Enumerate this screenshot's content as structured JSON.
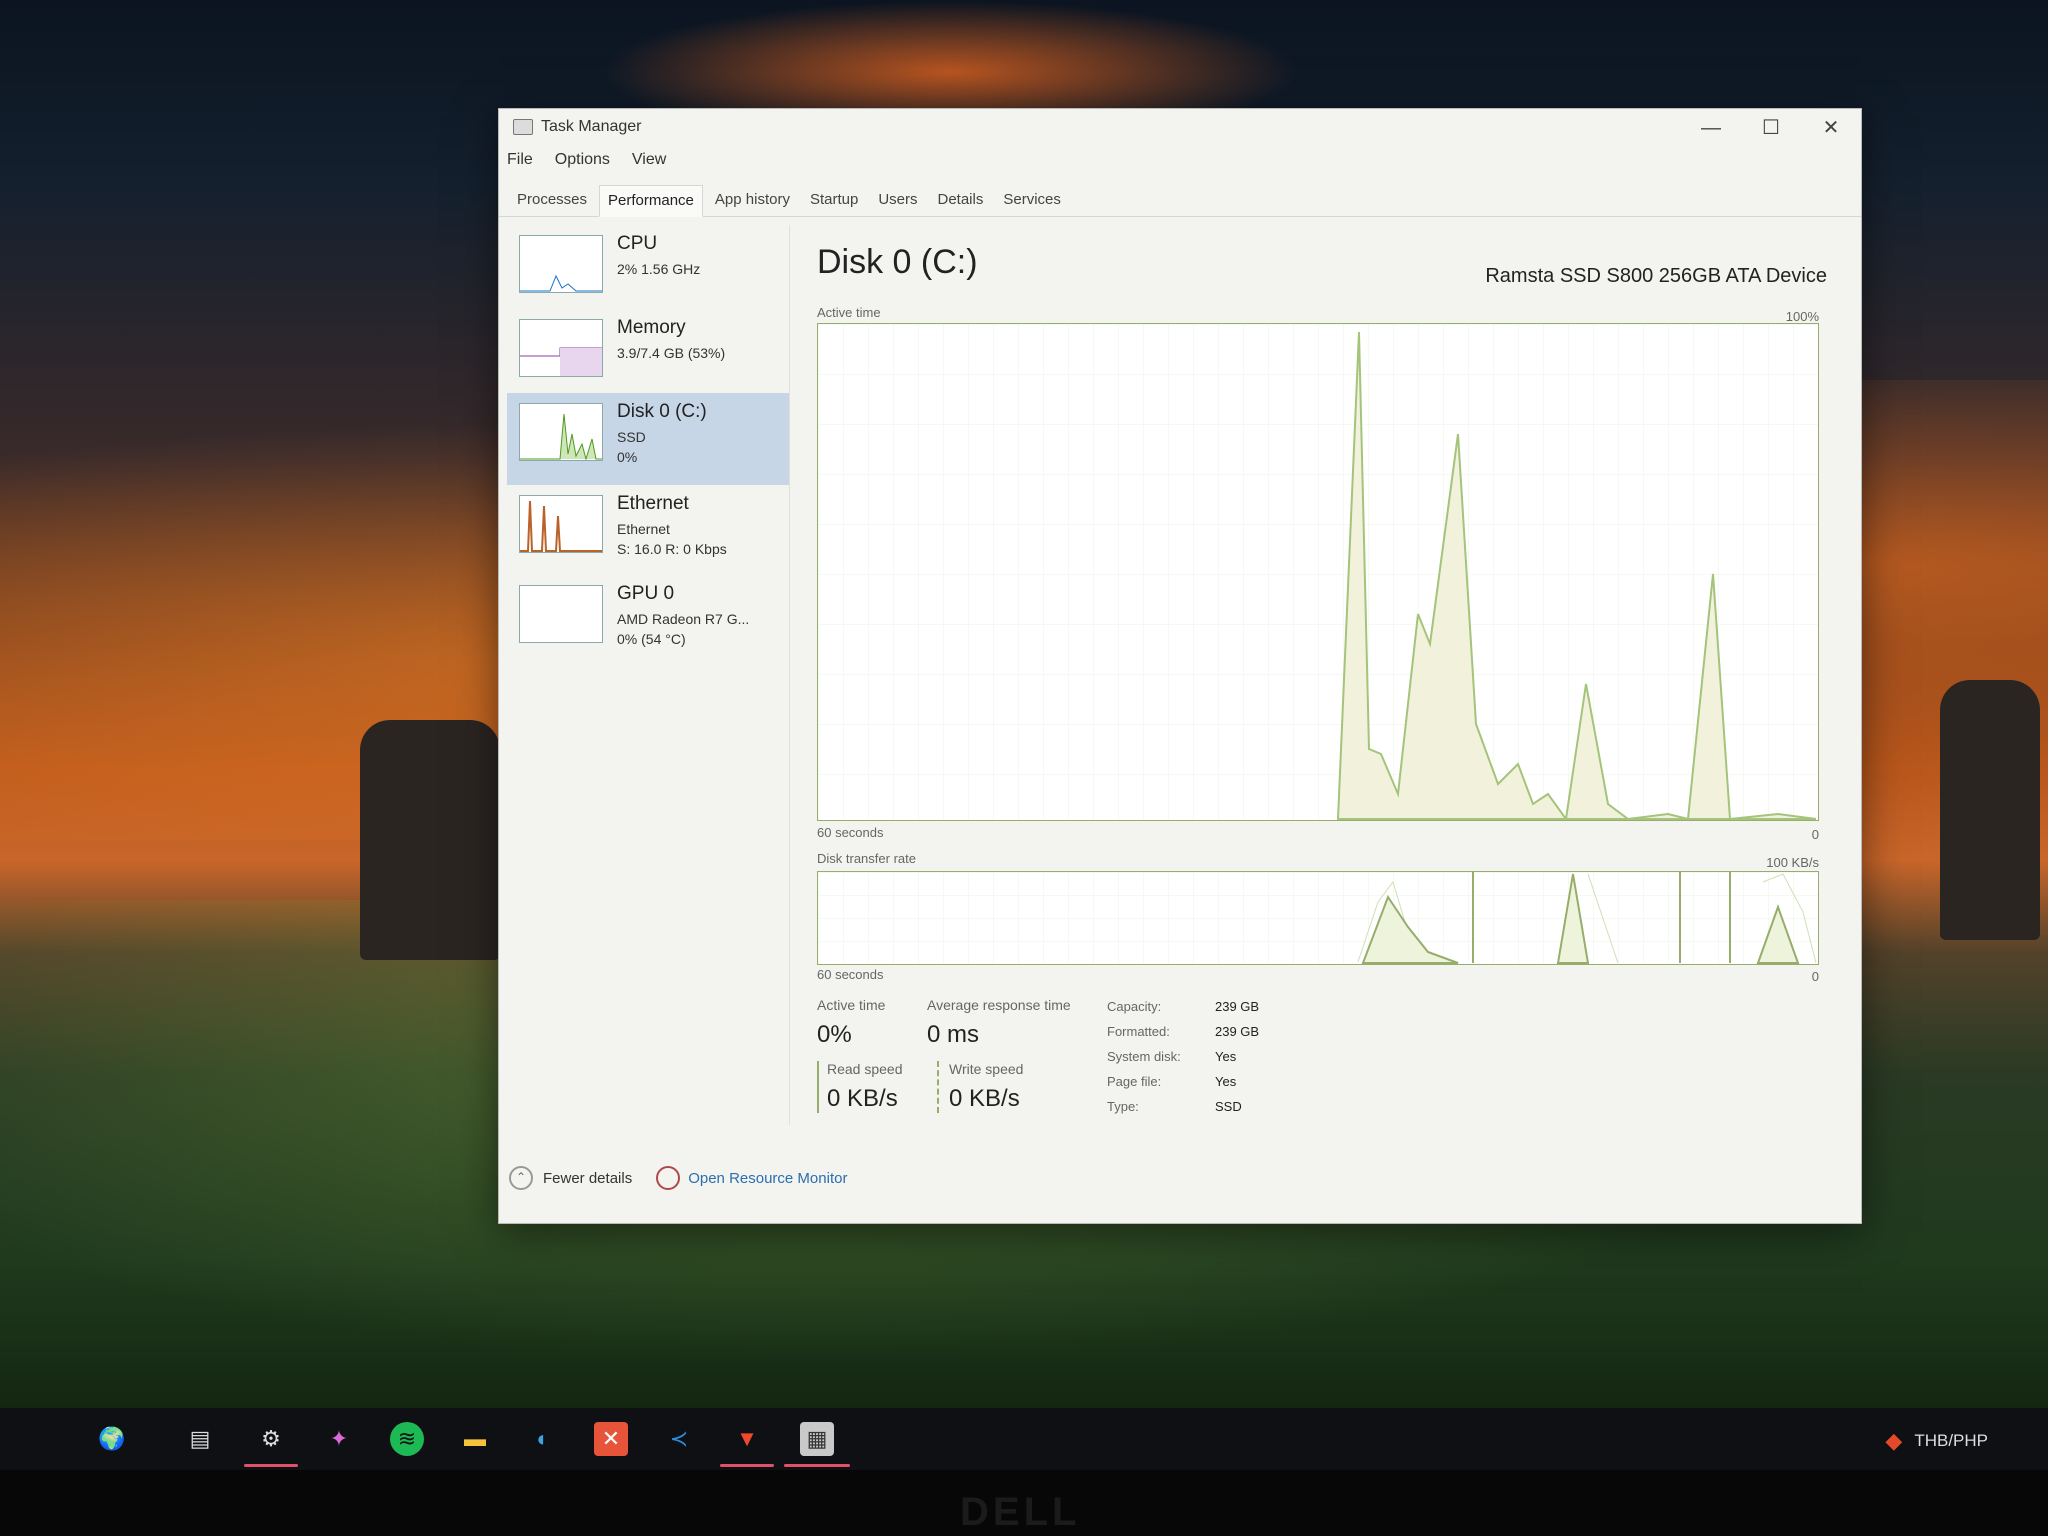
{
  "window": {
    "title": "Task Manager",
    "controls": {
      "minimize": "—",
      "maximize": "☐",
      "close": "✕"
    }
  },
  "menu": [
    "File",
    "Options",
    "View"
  ],
  "tabs": [
    {
      "label": "Processes",
      "active": false
    },
    {
      "label": "Performance",
      "active": true
    },
    {
      "label": "App history",
      "active": false
    },
    {
      "label": "Startup",
      "active": false
    },
    {
      "label": "Users",
      "active": false
    },
    {
      "label": "Details",
      "active": false
    },
    {
      "label": "Services",
      "active": false
    }
  ],
  "sidebar": [
    {
      "name": "CPU",
      "line1": "2% 1.56 GHz",
      "line2": "",
      "line3": "",
      "color": "#1a73c9"
    },
    {
      "name": "Memory",
      "line1": "3.9/7.4 GB (53%)",
      "line2": "",
      "line3": "",
      "color": "#8b3fa8"
    },
    {
      "name": "Disk 0 (C:)",
      "line1": "SSD",
      "line2": "0%",
      "line3": "",
      "color": "#4d9a1f"
    },
    {
      "name": "Ethernet",
      "line1": "Ethernet",
      "line2": "S: 16.0 R: 0 Kbps",
      "line3": "",
      "color": "#b9632a"
    },
    {
      "name": "GPU 0",
      "line1": "AMD Radeon R7 G...",
      "line2": "0% (54 °C)",
      "line3": "",
      "color": "#1a73c9"
    }
  ],
  "main": {
    "title": "Disk 0 (C:)",
    "device": "Ramsta SSD S800 256GB ATA Device",
    "graph1": {
      "label": "Active time",
      "max": "100%",
      "time": "60 seconds",
      "min": "0"
    },
    "graph2": {
      "label": "Disk transfer rate",
      "max": "100 KB/s",
      "time": "60 seconds",
      "min": "0"
    },
    "stats": {
      "active_time_label": "Active time",
      "active_time": "0%",
      "response_label": "Average response time",
      "response": "0 ms",
      "read_label": "Read speed",
      "read": "0 KB/s",
      "write_label": "Write speed",
      "write": "0 KB/s"
    },
    "props": [
      {
        "k": "Capacity:",
        "v": "239 GB"
      },
      {
        "k": "Formatted:",
        "v": "239 GB"
      },
      {
        "k": "System disk:",
        "v": "Yes"
      },
      {
        "k": "Page file:",
        "v": "Yes"
      },
      {
        "k": "Type:",
        "v": "SSD"
      }
    ]
  },
  "footer": {
    "fewer": "Fewer details",
    "monitor": "Open Resource Monitor"
  },
  "taskbar": {
    "icons": [
      "map-icon",
      "task-view-icon",
      "settings-icon",
      "copilot-icon",
      "spotify-icon",
      "file-explorer-icon",
      "edge-icon",
      "xampp-icon",
      "vscode-icon",
      "brave-icon",
      "task-manager-icon"
    ],
    "tray_text": "THB/PHP"
  },
  "brand": "DELL"
}
